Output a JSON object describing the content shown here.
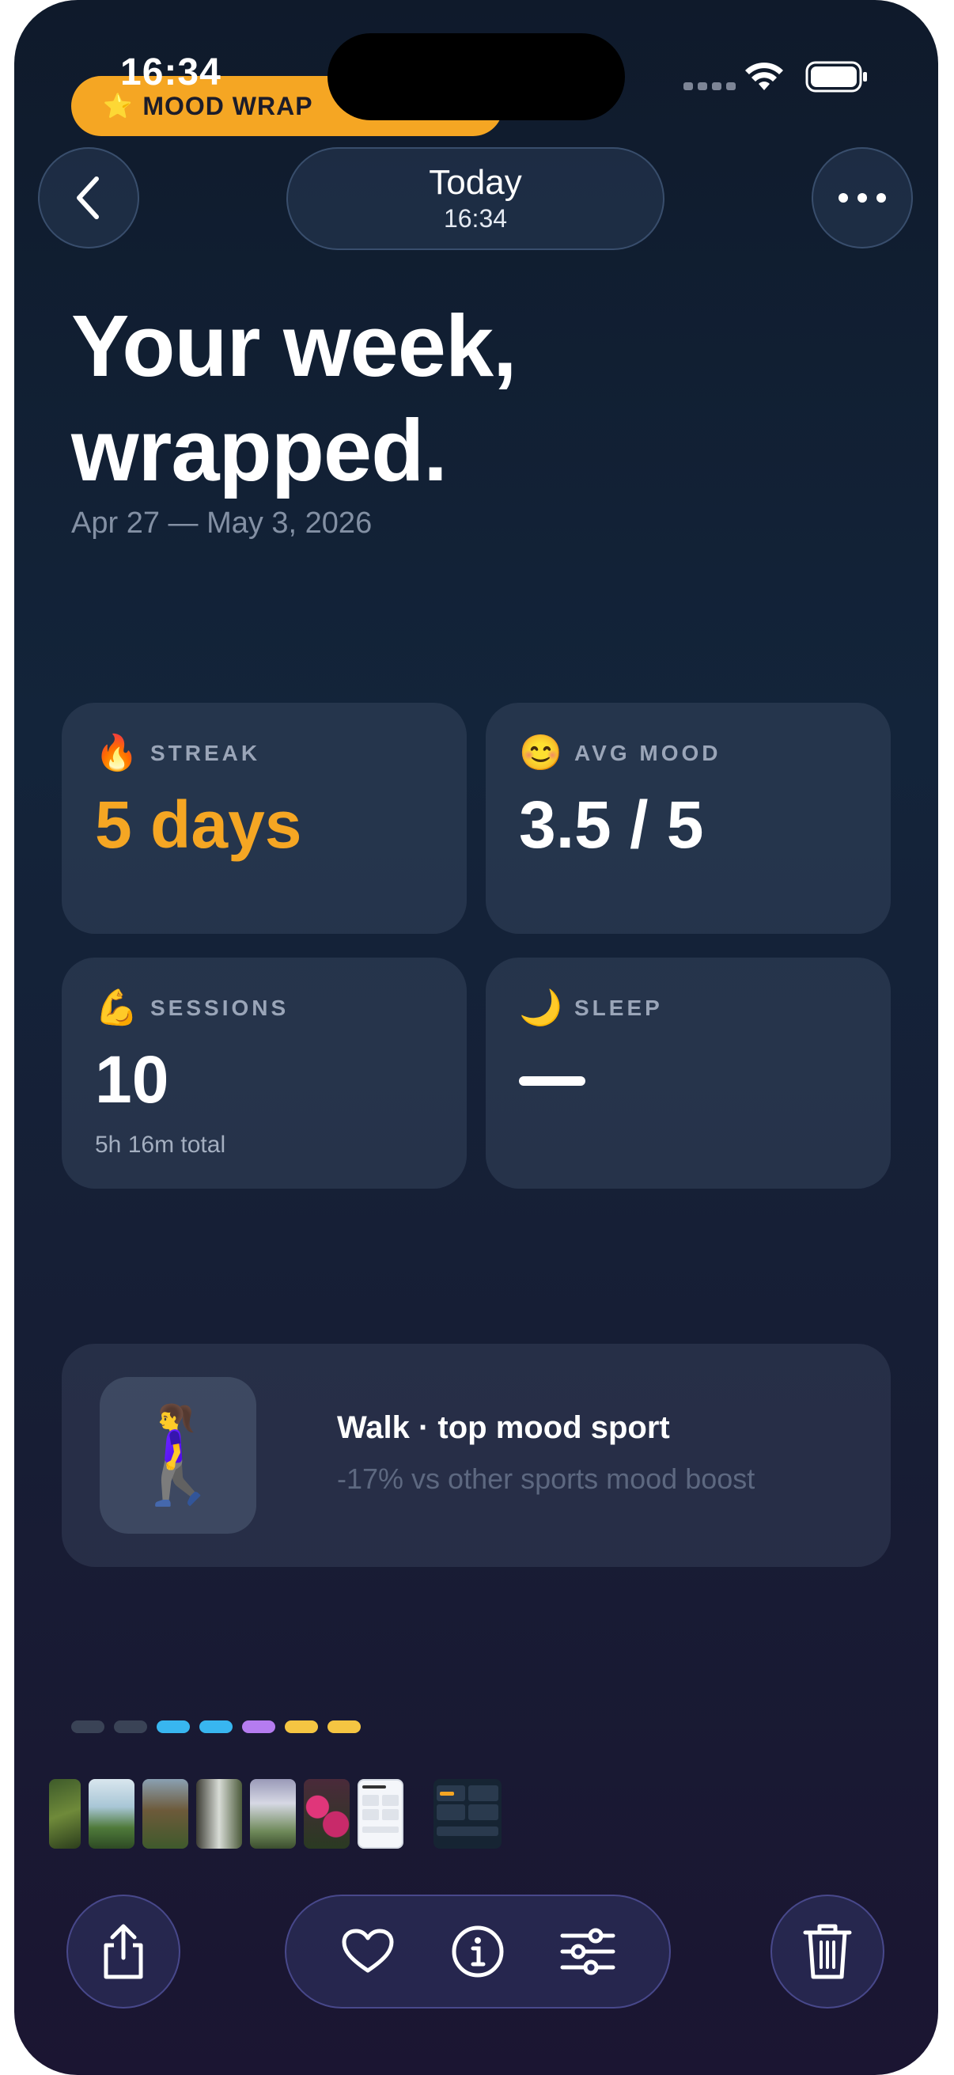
{
  "status_bar": {
    "time": "16:34"
  },
  "banner": {
    "star": "⭐",
    "label": "MOOD WRAP"
  },
  "header": {
    "title": "Today",
    "time": "16:34"
  },
  "hero": {
    "line1": "Your week,",
    "line2": "wrapped.",
    "date_range": "Apr 27 — May 3, 2026"
  },
  "stats": {
    "streak": {
      "emoji": "🔥",
      "label": "STREAK",
      "value": "5 days"
    },
    "avg_mood": {
      "emoji": "😊",
      "label": "AVG MOOD",
      "value": "3.5 / 5"
    },
    "sessions": {
      "emoji": "💪",
      "label": "SESSIONS",
      "value": "10",
      "sub": "5h 16m total"
    },
    "sleep": {
      "emoji": "🌙",
      "label": "SLEEP"
    }
  },
  "top_sport": {
    "emoji": "🚶‍♀️",
    "title": "Walk · top mood sport",
    "subtitle": "-17% vs other sports mood boost"
  },
  "page_dots": [
    "#3a4356",
    "#3a4356",
    "#38b6f0",
    "#38b6f0",
    "#b57cf0",
    "#f5c542",
    "#f5c542"
  ],
  "thumbnails": [
    "leaf",
    "flower",
    "waterfall",
    "cascade",
    "falls",
    "blossoms",
    "app-screenshot",
    "dark-app-screenshot"
  ],
  "colors": {
    "accent": "#f5a623",
    "background": "#13243a"
  },
  "icons": {
    "back": "chevron-left-icon",
    "more": "ellipsis-icon",
    "share": "share-icon",
    "favorite": "heart-icon",
    "info": "info-icon",
    "adjust": "sliders-icon",
    "delete": "trash-icon"
  }
}
